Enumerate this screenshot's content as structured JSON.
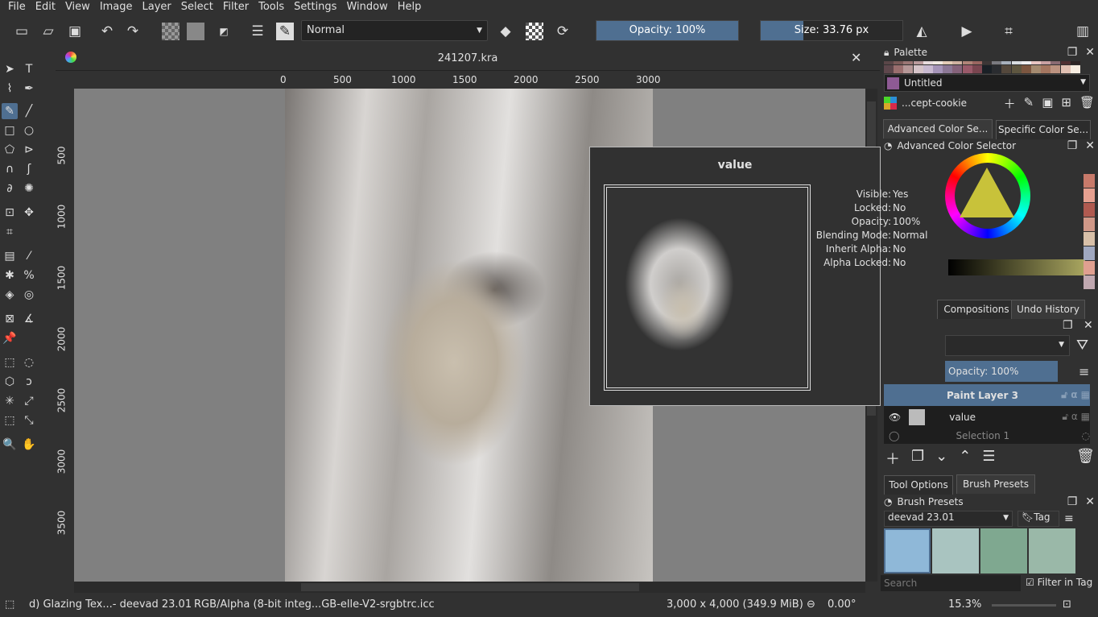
{
  "menu": [
    "File",
    "Edit",
    "View",
    "Image",
    "Layer",
    "Select",
    "Filter",
    "Tools",
    "Settings",
    "Window",
    "Help"
  ],
  "toolbar": {
    "blend_mode": "Normal",
    "opacity": "Opacity: 100%",
    "opacity_value": 100,
    "size": "Size: 33.76 px"
  },
  "document": {
    "tab_title": "241207.kra"
  },
  "ruler_h": [
    "0",
    "500",
    "1000",
    "1500",
    "2000",
    "2500",
    "3000"
  ],
  "ruler_v": [
    "500",
    "1000",
    "1500",
    "2000",
    "2500",
    "3000",
    "3500"
  ],
  "popup": {
    "title": "value",
    "props": [
      [
        "Visible:",
        "Yes"
      ],
      [
        "Locked:",
        "No"
      ],
      [
        "Opacity:",
        "100%"
      ],
      [
        "Blending Mode:",
        "Normal"
      ],
      [
        "Inherit Alpha:",
        "No"
      ],
      [
        "Alpha Locked:",
        "No"
      ]
    ]
  },
  "palette": {
    "title": "Palette",
    "selected": "Untitled",
    "selected_color": "#8e5a94",
    "palette_name": "...cept-cookie",
    "row1": [
      "#5a4648",
      "#7a5a58",
      "#9a7674",
      "#b99a9c",
      "#e7dbdd",
      "#f0e8e0",
      "#e2cbb6",
      "#cfb0a0",
      "#b08478",
      "#9a6660",
      "#3c3636",
      "#7a7a80",
      "#a8b0bc",
      "#d8dce0",
      "#eeeef0",
      "#e7c4c2",
      "#c8a0a2",
      "#8a6a72",
      "#4e3032",
      "#2c2424"
    ],
    "row2": [
      "#5e474c",
      "#9a6e6e",
      "#b59797",
      "#d5c3c8",
      "#c8b9d0",
      "#a594b8",
      "#8c7896",
      "#85627a",
      "#9a5a6a",
      "#7a4650",
      "#1a2026",
      "#2a2c30",
      "#54483c",
      "#5e5640",
      "#7c5640",
      "#a48a70",
      "#a47660",
      "#bc9280",
      "#e0c0b2",
      "#f6ece0"
    ]
  },
  "color_tabs": [
    "Advanced Color Se...",
    "Specific Color Se..."
  ],
  "color_selector": {
    "title": "Advanced Color Selector",
    "recent": [
      "#c87a6a",
      "#e6a090",
      "#b05a50",
      "#d09888",
      "#d8c0a8",
      "#a0a8c0",
      "#e0a090",
      "#c0a8b0"
    ]
  },
  "layer_tabs": [
    "Compositions",
    "Undo History"
  ],
  "layers": {
    "opacity": "Opacity:  100%",
    "items": [
      {
        "name": "Paint Layer 3",
        "active": true
      },
      {
        "name": "value",
        "active": false
      },
      {
        "name": "Selection 1",
        "active": false
      }
    ]
  },
  "lower_tabs": [
    "Tool Options",
    "Brush Presets"
  ],
  "brush_presets": {
    "title": "Brush Presets",
    "tag_set": "deevad 23.01",
    "tag_label": "Tag",
    "search_placeholder": "Search",
    "filter_in_tag": "Filter in Tag"
  },
  "status": {
    "brush": "d) Glazing Tex...- deevad 23.01",
    "color_space": "RGB/Alpha (8-bit integ...GB-elle-V2-srgbtrc.icc",
    "dimensions": "3,000 x 4,000 (349.9 MiB)",
    "rotation": "0.00°",
    "zoom": "15.3%"
  }
}
